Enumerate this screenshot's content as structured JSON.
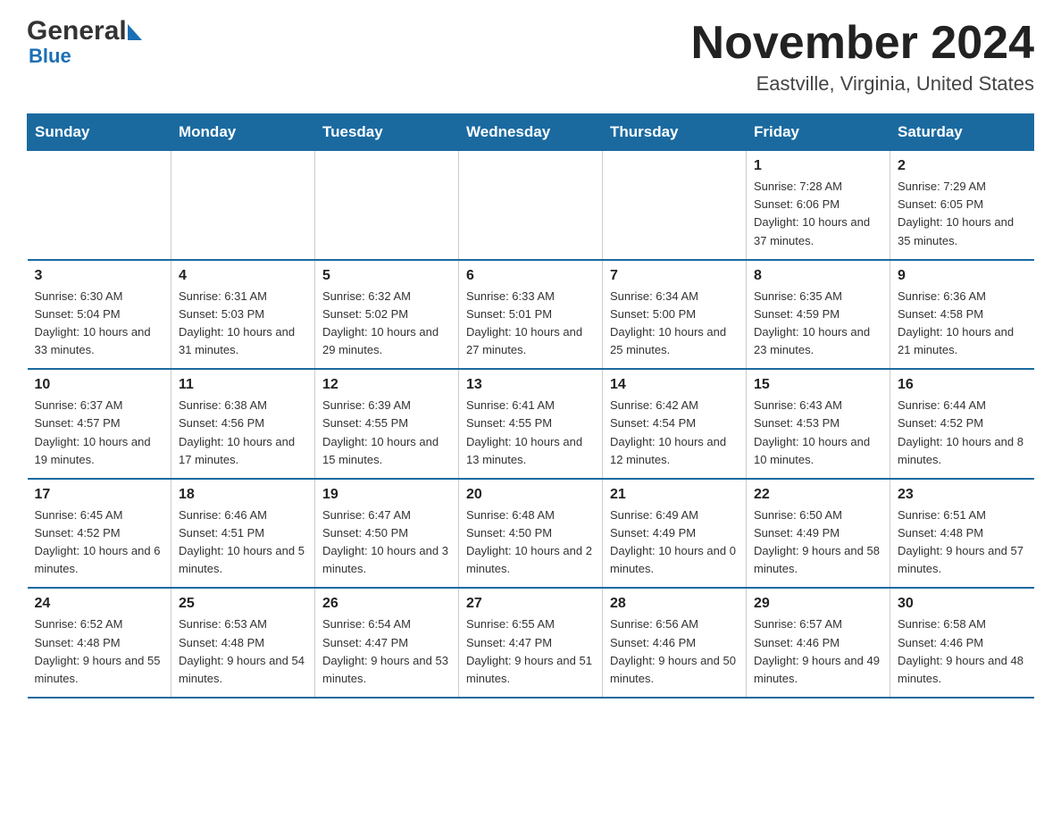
{
  "logo": {
    "name_part1": "General",
    "name_part2": "Blue",
    "sub": "Blue"
  },
  "title": "November 2024",
  "subtitle": "Eastville, Virginia, United States",
  "weekdays": [
    "Sunday",
    "Monday",
    "Tuesday",
    "Wednesday",
    "Thursday",
    "Friday",
    "Saturday"
  ],
  "weeks": [
    [
      {
        "day": "",
        "sunrise": "",
        "sunset": "",
        "daylight": ""
      },
      {
        "day": "",
        "sunrise": "",
        "sunset": "",
        "daylight": ""
      },
      {
        "day": "",
        "sunrise": "",
        "sunset": "",
        "daylight": ""
      },
      {
        "day": "",
        "sunrise": "",
        "sunset": "",
        "daylight": ""
      },
      {
        "day": "",
        "sunrise": "",
        "sunset": "",
        "daylight": ""
      },
      {
        "day": "1",
        "sunrise": "Sunrise: 7:28 AM",
        "sunset": "Sunset: 6:06 PM",
        "daylight": "Daylight: 10 hours and 37 minutes."
      },
      {
        "day": "2",
        "sunrise": "Sunrise: 7:29 AM",
        "sunset": "Sunset: 6:05 PM",
        "daylight": "Daylight: 10 hours and 35 minutes."
      }
    ],
    [
      {
        "day": "3",
        "sunrise": "Sunrise: 6:30 AM",
        "sunset": "Sunset: 5:04 PM",
        "daylight": "Daylight: 10 hours and 33 minutes."
      },
      {
        "day": "4",
        "sunrise": "Sunrise: 6:31 AM",
        "sunset": "Sunset: 5:03 PM",
        "daylight": "Daylight: 10 hours and 31 minutes."
      },
      {
        "day": "5",
        "sunrise": "Sunrise: 6:32 AM",
        "sunset": "Sunset: 5:02 PM",
        "daylight": "Daylight: 10 hours and 29 minutes."
      },
      {
        "day": "6",
        "sunrise": "Sunrise: 6:33 AM",
        "sunset": "Sunset: 5:01 PM",
        "daylight": "Daylight: 10 hours and 27 minutes."
      },
      {
        "day": "7",
        "sunrise": "Sunrise: 6:34 AM",
        "sunset": "Sunset: 5:00 PM",
        "daylight": "Daylight: 10 hours and 25 minutes."
      },
      {
        "day": "8",
        "sunrise": "Sunrise: 6:35 AM",
        "sunset": "Sunset: 4:59 PM",
        "daylight": "Daylight: 10 hours and 23 minutes."
      },
      {
        "day": "9",
        "sunrise": "Sunrise: 6:36 AM",
        "sunset": "Sunset: 4:58 PM",
        "daylight": "Daylight: 10 hours and 21 minutes."
      }
    ],
    [
      {
        "day": "10",
        "sunrise": "Sunrise: 6:37 AM",
        "sunset": "Sunset: 4:57 PM",
        "daylight": "Daylight: 10 hours and 19 minutes."
      },
      {
        "day": "11",
        "sunrise": "Sunrise: 6:38 AM",
        "sunset": "Sunset: 4:56 PM",
        "daylight": "Daylight: 10 hours and 17 minutes."
      },
      {
        "day": "12",
        "sunrise": "Sunrise: 6:39 AM",
        "sunset": "Sunset: 4:55 PM",
        "daylight": "Daylight: 10 hours and 15 minutes."
      },
      {
        "day": "13",
        "sunrise": "Sunrise: 6:41 AM",
        "sunset": "Sunset: 4:55 PM",
        "daylight": "Daylight: 10 hours and 13 minutes."
      },
      {
        "day": "14",
        "sunrise": "Sunrise: 6:42 AM",
        "sunset": "Sunset: 4:54 PM",
        "daylight": "Daylight: 10 hours and 12 minutes."
      },
      {
        "day": "15",
        "sunrise": "Sunrise: 6:43 AM",
        "sunset": "Sunset: 4:53 PM",
        "daylight": "Daylight: 10 hours and 10 minutes."
      },
      {
        "day": "16",
        "sunrise": "Sunrise: 6:44 AM",
        "sunset": "Sunset: 4:52 PM",
        "daylight": "Daylight: 10 hours and 8 minutes."
      }
    ],
    [
      {
        "day": "17",
        "sunrise": "Sunrise: 6:45 AM",
        "sunset": "Sunset: 4:52 PM",
        "daylight": "Daylight: 10 hours and 6 minutes."
      },
      {
        "day": "18",
        "sunrise": "Sunrise: 6:46 AM",
        "sunset": "Sunset: 4:51 PM",
        "daylight": "Daylight: 10 hours and 5 minutes."
      },
      {
        "day": "19",
        "sunrise": "Sunrise: 6:47 AM",
        "sunset": "Sunset: 4:50 PM",
        "daylight": "Daylight: 10 hours and 3 minutes."
      },
      {
        "day": "20",
        "sunrise": "Sunrise: 6:48 AM",
        "sunset": "Sunset: 4:50 PM",
        "daylight": "Daylight: 10 hours and 2 minutes."
      },
      {
        "day": "21",
        "sunrise": "Sunrise: 6:49 AM",
        "sunset": "Sunset: 4:49 PM",
        "daylight": "Daylight: 10 hours and 0 minutes."
      },
      {
        "day": "22",
        "sunrise": "Sunrise: 6:50 AM",
        "sunset": "Sunset: 4:49 PM",
        "daylight": "Daylight: 9 hours and 58 minutes."
      },
      {
        "day": "23",
        "sunrise": "Sunrise: 6:51 AM",
        "sunset": "Sunset: 4:48 PM",
        "daylight": "Daylight: 9 hours and 57 minutes."
      }
    ],
    [
      {
        "day": "24",
        "sunrise": "Sunrise: 6:52 AM",
        "sunset": "Sunset: 4:48 PM",
        "daylight": "Daylight: 9 hours and 55 minutes."
      },
      {
        "day": "25",
        "sunrise": "Sunrise: 6:53 AM",
        "sunset": "Sunset: 4:48 PM",
        "daylight": "Daylight: 9 hours and 54 minutes."
      },
      {
        "day": "26",
        "sunrise": "Sunrise: 6:54 AM",
        "sunset": "Sunset: 4:47 PM",
        "daylight": "Daylight: 9 hours and 53 minutes."
      },
      {
        "day": "27",
        "sunrise": "Sunrise: 6:55 AM",
        "sunset": "Sunset: 4:47 PM",
        "daylight": "Daylight: 9 hours and 51 minutes."
      },
      {
        "day": "28",
        "sunrise": "Sunrise: 6:56 AM",
        "sunset": "Sunset: 4:46 PM",
        "daylight": "Daylight: 9 hours and 50 minutes."
      },
      {
        "day": "29",
        "sunrise": "Sunrise: 6:57 AM",
        "sunset": "Sunset: 4:46 PM",
        "daylight": "Daylight: 9 hours and 49 minutes."
      },
      {
        "day": "30",
        "sunrise": "Sunrise: 6:58 AM",
        "sunset": "Sunset: 4:46 PM",
        "daylight": "Daylight: 9 hours and 48 minutes."
      }
    ]
  ]
}
